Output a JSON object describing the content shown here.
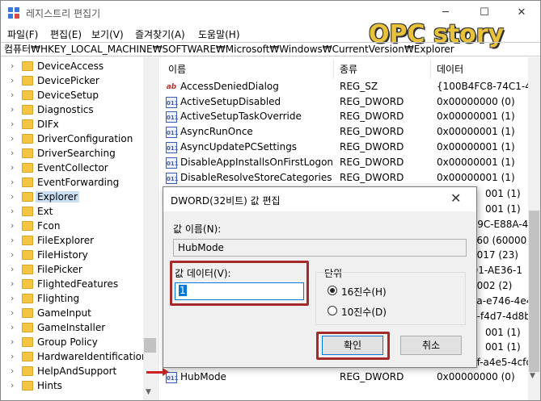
{
  "window": {
    "title": "레지스트리 편집기",
    "minimize": "─",
    "maximize": "☐",
    "close": "✕"
  },
  "watermark": "OPC story",
  "menu": [
    "파일(F)",
    "편집(E)",
    "보기(V)",
    "즐겨찾기(A)",
    "도움말(H)"
  ],
  "address": "컴퓨터₩HKEY_LOCAL_MACHINE₩SOFTWARE₩Microsoft₩Windows₩CurrentVersion₩Explorer",
  "tree": [
    "DeviceAccess",
    "DevicePicker",
    "DeviceSetup",
    "Diagnostics",
    "DIFx",
    "DriverConfiguration",
    "DriverSearching",
    "EventCollector",
    "EventForwarding",
    "Explorer",
    "Ext",
    "Fcon",
    "FileExplorer",
    "FileHistory",
    "FilePicker",
    "FlightedFeatures",
    "Flighting",
    "GameInput",
    "GameInstaller",
    "Group Policy",
    "HardwareIdentification",
    "HelpAndSupport",
    "Hints"
  ],
  "tree_selected": "Explorer",
  "list": {
    "headers": {
      "name": "이름",
      "type": "종류",
      "data": "데이터"
    },
    "rows": [
      {
        "name": "AccessDeniedDialog",
        "type": "REG_SZ",
        "data": "{100B4FC8-74C1-47",
        "icon": "sz"
      },
      {
        "name": "ActiveSetupDisabled",
        "type": "REG_DWORD",
        "data": "0x00000000 (0)",
        "icon": "dw"
      },
      {
        "name": "ActiveSetupTaskOverride",
        "type": "REG_DWORD",
        "data": "0x00000001 (1)",
        "icon": "dw"
      },
      {
        "name": "AsyncRunOnce",
        "type": "REG_DWORD",
        "data": "0x00000001 (1)",
        "icon": "dw"
      },
      {
        "name": "AsyncUpdatePCSettings",
        "type": "REG_DWORD",
        "data": "0x00000001 (1)",
        "icon": "dw"
      },
      {
        "name": "DisableAppInstallsOnFirstLogon",
        "type": "REG_DWORD",
        "data": "0x00000001 (1)",
        "icon": "dw"
      },
      {
        "name": "DisableResolveStoreCategories",
        "type": "REG_DWORD",
        "data": "0x00000001 (1)",
        "icon": "dw"
      }
    ],
    "hidden_data_fragments": [
      "001 (1)",
      "001 (1)",
      "A9C-E88A-4",
      "a60 (60000",
      "0017 (23)",
      "D1-AE36-1",
      "0002 (2)",
      "ea-e746-4e4",
      "8-f4d7-4d8b",
      "001 (1)",
      "001 (1)",
      "9f-a4e5-4cfc"
    ],
    "last_row": {
      "name": "HubMode",
      "type": "REG_DWORD",
      "data": "0x00000000 (0)"
    }
  },
  "dialog": {
    "title": "DWORD(32비트) 값 편집",
    "close": "✕",
    "value_name_label": "값 이름(N):",
    "value_name": "HubMode",
    "value_data_label": "값 데이터(V):",
    "value_data": "1",
    "radix_label": "단위",
    "hex_label": "16진수(H)",
    "dec_label": "10진수(D)",
    "radix_selected": "hex",
    "ok": "확인",
    "cancel": "취소"
  },
  "colors": {
    "highlight_box": "#a52a2a",
    "arrow": "#cc2222",
    "selection": "#0078d7"
  }
}
